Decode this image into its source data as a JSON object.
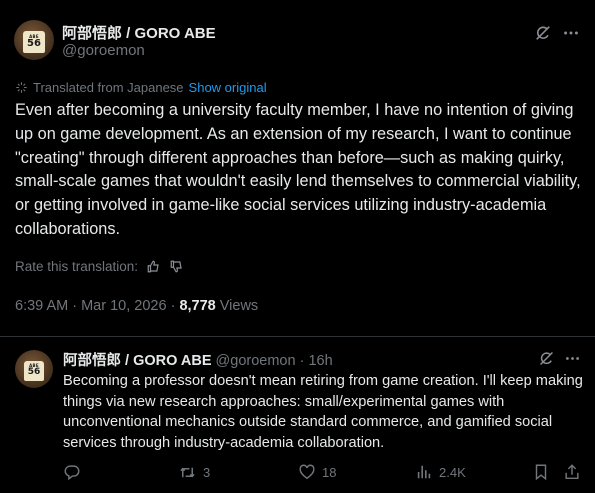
{
  "tweet": {
    "author_name": "阿部悟郎 / GORO ABE",
    "author_handle": "@goroemon",
    "avatar": {
      "jersey_small_text": "ABE",
      "jersey_number": "56"
    },
    "translated_from": "Translated from Japanese",
    "show_original": "Show original",
    "text": "Even after becoming a university faculty member, I have no intention of giving up on game development. As an extension of my research, I want to continue \"creating\" through different approaches than before—such as making quirky, small-scale games that wouldn't easily lend themselves to commercial viability, or getting involved in game-like social services utilizing industry-academia collaborations.",
    "rate_translation": "Rate this translation:",
    "time": "6:39 AM",
    "date": "Mar 10, 2026",
    "views_count": "8,778",
    "views_label": "Views"
  },
  "reply": {
    "author_name": "阿部悟郎 / GORO ABE",
    "author_handle": "@goroemon",
    "age": "16h",
    "avatar": {
      "jersey_small_text": "ABE",
      "jersey_number": "56"
    },
    "text": "Becoming a professor doesn't mean retiring from game creation. I'll keep making things via new research approaches: small/experimental games with unconventional mechanics outside standard commerce, and gamified social services through industry-academia collaboration.",
    "reposts": "3",
    "likes": "18",
    "views": "2.4K"
  },
  "icons": [
    "grok-icon",
    "more-icon",
    "translate-icon",
    "thumbs-up-icon",
    "thumbs-down-icon",
    "reply-icon",
    "repost-icon",
    "like-icon",
    "views-icon",
    "bookmark-icon",
    "share-icon"
  ]
}
